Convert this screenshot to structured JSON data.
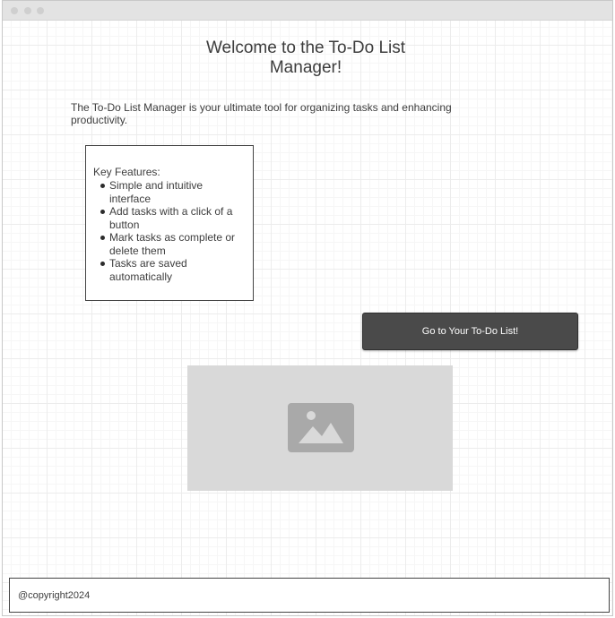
{
  "page": {
    "title": "Welcome to the To-Do List Manager!",
    "intro": "The To-Do List Manager is your ultimate tool for organizing tasks and enhancing productivity."
  },
  "features": {
    "heading": "Key Features:",
    "items": [
      "Simple and intuitive interface",
      "Add tasks with a click of a button",
      "Mark tasks as complete or delete them",
      "Tasks are saved automatically"
    ]
  },
  "cta": {
    "label": "Go to Your To-Do List!"
  },
  "image": {
    "icon": "image-icon"
  },
  "footer": {
    "text": "@copyright2024"
  },
  "colors": {
    "button_bg": "#4a4a4a",
    "button_text": "#ffffff",
    "placeholder_bg": "#d9d9d9",
    "text": "#3d3d3d"
  }
}
